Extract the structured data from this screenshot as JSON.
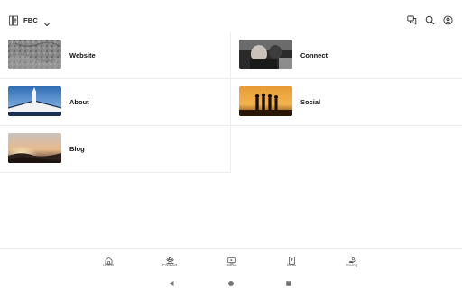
{
  "header": {
    "org_name": "FBC"
  },
  "tiles": [
    {
      "label": "Website"
    },
    {
      "label": "Connect"
    },
    {
      "label": "About"
    },
    {
      "label": "Social"
    },
    {
      "label": "Blog"
    }
  ],
  "bottom_nav": {
    "items": [
      {
        "label": "Home",
        "icon": "home-icon"
      },
      {
        "label": "Connect",
        "icon": "people-icon",
        "active": true
      },
      {
        "label": "Media",
        "icon": "media-icon"
      },
      {
        "label": "Bible",
        "icon": "bible-icon"
      },
      {
        "label": "Giving",
        "icon": "giving-icon"
      }
    ]
  },
  "colors": {
    "text": "#111111",
    "divider": "#ececec",
    "muted": "#666666"
  }
}
